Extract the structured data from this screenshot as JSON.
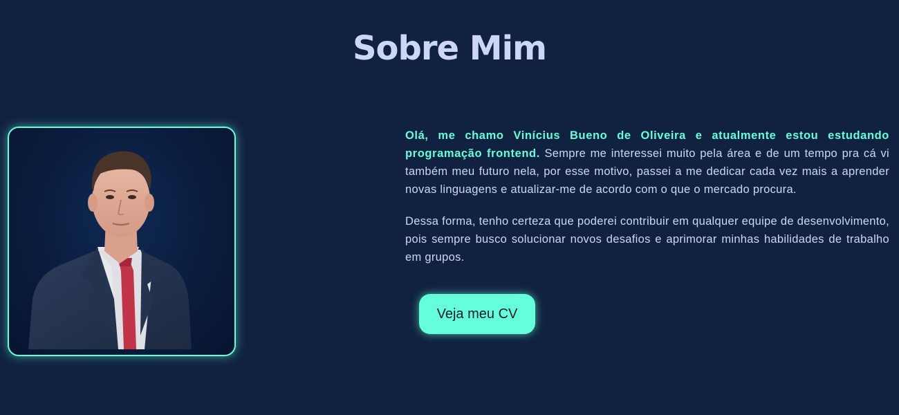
{
  "section": {
    "title": "Sobre Mim"
  },
  "profile_photo": {
    "subject": "portrait of a young man in a dark suit, white shirt and red tie"
  },
  "about": {
    "intro_highlight": "Olá, me chamo Vinícius Bueno de Oliveira e atualmente estou estudando programação frontend.",
    "intro_rest": "Sempre me interessei muito pela área e de um tempo pra cá vi também meu futuro nela, por esse motivo, passei a me dedicar cada vez mais a aprender novas linguagens e atualizar-me de acordo com o que o mercado procura.",
    "paragraph_2": "Dessa forma, tenho certeza que poderei contribuir em qualquer equipe de desenvolvimento, pois sempre busco solucionar novos desafios e aprimorar minhas habilidades de trabalho em grupos."
  },
  "cv_button": {
    "label": "Veja meu CV"
  },
  "colors": {
    "background": "#112240",
    "accent": "#64ffda",
    "text": "#ccd6f6",
    "button_text": "#0a192f"
  }
}
